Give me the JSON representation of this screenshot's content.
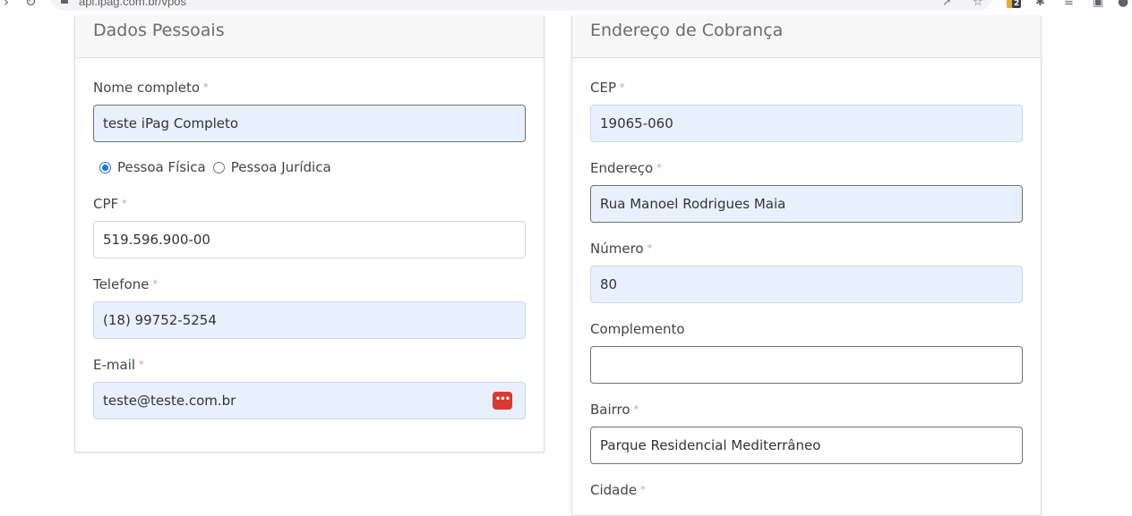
{
  "browser": {
    "url": "api.ipag.com.br/vpos",
    "extension_badge": "2"
  },
  "personal": {
    "title": "Dados Pessoais",
    "name_label": "Nome completo",
    "name_value": "teste iPag Completo",
    "person_type_options": [
      "Pessoa Física",
      "Pessoa Jurídica"
    ],
    "person_type_selected": "Pessoa Física",
    "cpf_label": "CPF",
    "cpf_value": "519.596.900-00",
    "phone_label": "Telefone",
    "phone_value": "(18) 99752-5254",
    "email_label": "E-mail",
    "email_value": "teste@teste.com.br",
    "required_mark": "*"
  },
  "billing": {
    "title": "Endereço de Cobrança",
    "cep_label": "CEP",
    "cep_value": "19065-060",
    "address_label": "Endereço",
    "address_value": "Rua Manoel Rodrigues Maia",
    "number_label": "Número",
    "number_value": "80",
    "complement_label": "Complemento",
    "complement_value": "",
    "district_label": "Bairro",
    "district_value": "Parque Residencial Mediterrâneo",
    "city_label": "Cidade",
    "required_mark": "*"
  },
  "colors": {
    "autofill_bg": "#e8f0fe",
    "required": "#e88a8a",
    "radio_accent": "#1a73e8",
    "password_manager": "#d93b30"
  },
  "icons": {
    "password_manager": "password-manager-icon"
  }
}
